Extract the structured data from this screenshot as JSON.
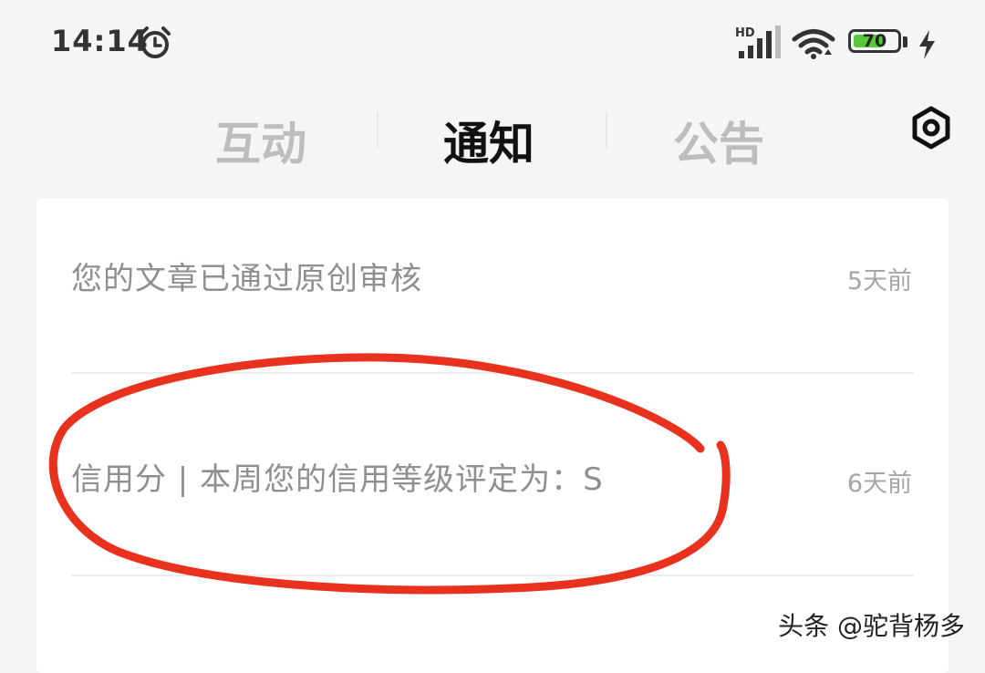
{
  "status_bar": {
    "time": "14:14",
    "network_label": "HD",
    "battery_level": "70",
    "battery_percent": 70,
    "battery_color": "#5ac738"
  },
  "tabs": [
    {
      "label": "互动",
      "active": false
    },
    {
      "label": "通知",
      "active": true
    },
    {
      "label": "公告",
      "active": false
    }
  ],
  "settings_icon": "settings-hexagon-icon",
  "notifications": [
    {
      "title": "您的文章已通过原创审核",
      "time": "5天前"
    },
    {
      "title": "信用分 | 本周您的信用等级评定为：S",
      "time": "6天前"
    }
  ],
  "annotation_color": "#e8321e",
  "watermark": "头条 @驼背杨多"
}
